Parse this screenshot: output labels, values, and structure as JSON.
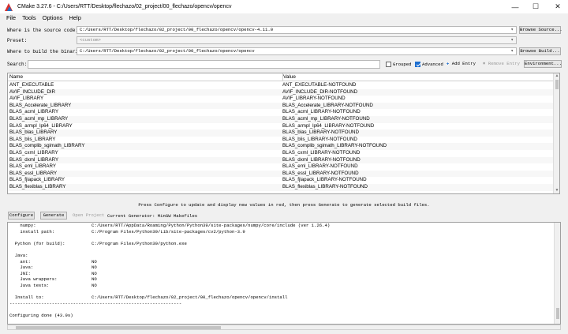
{
  "window": {
    "title": "CMake 3.27.6 - C:/Users/RTT/Desktop/flechazo/02_project/00_flechazo/opencv/opencv",
    "minimize": "—",
    "maximize": "☐",
    "close": "✕"
  },
  "menu": [
    "File",
    "Tools",
    "Options",
    "Help"
  ],
  "source": {
    "label": "Where is the source code:",
    "value": "C:/Users/RTT/Desktop/flechazo/02_project/00_flechazo/opencv/opencv-4.11.0",
    "browse_label": "Browse Source..."
  },
  "preset": {
    "label": "Preset:",
    "value": "<custom>"
  },
  "build": {
    "label": "Where to build the binaries:",
    "value": "C:/Users/RTT/Desktop/flechazo/02_project/00_flechazo/opencv/opencv",
    "browse_label": "Browse Build..."
  },
  "search": {
    "label": "Search:",
    "value": "",
    "grouped_label": "Grouped",
    "grouped_checked": false,
    "advanced_label": "Advanced",
    "advanced_checked": true,
    "add_entry_label": "Add Entry",
    "remove_entry_label": "Remove Entry",
    "environment_label": "Environment..."
  },
  "table": {
    "headers": [
      "Name",
      "Value"
    ],
    "rows": [
      {
        "name": "ANT_EXECUTABLE",
        "value": "ANT_EXECUTABLE-NOTFOUND"
      },
      {
        "name": "AVIF_INCLUDE_DIR",
        "value": "AVIF_INCLUDE_DIR-NOTFOUND"
      },
      {
        "name": "AVIF_LIBRARY",
        "value": "AVIF_LIBRARY-NOTFOUND"
      },
      {
        "name": "BLAS_Accelerate_LIBRARY",
        "value": "BLAS_Accelerate_LIBRARY-NOTFOUND"
      },
      {
        "name": "BLAS_acml_LIBRARY",
        "value": "BLAS_acml_LIBRARY-NOTFOUND"
      },
      {
        "name": "BLAS_acml_mp_LIBRARY",
        "value": "BLAS_acml_mp_LIBRARY-NOTFOUND"
      },
      {
        "name": "BLAS_armpl_lp64_LIBRARY",
        "value": "BLAS_armpl_lp64_LIBRARY-NOTFOUND"
      },
      {
        "name": "BLAS_blas_LIBRARY",
        "value": "BLAS_blas_LIBRARY-NOTFOUND"
      },
      {
        "name": "BLAS_blis_LIBRARY",
        "value": "BLAS_blis_LIBRARY-NOTFOUND"
      },
      {
        "name": "BLAS_complib_sgimath_LIBRARY",
        "value": "BLAS_complib_sgimath_LIBRARY-NOTFOUND"
      },
      {
        "name": "BLAS_cxml_LIBRARY",
        "value": "BLAS_cxml_LIBRARY-NOTFOUND"
      },
      {
        "name": "BLAS_dxml_LIBRARY",
        "value": "BLAS_dxml_LIBRARY-NOTFOUND"
      },
      {
        "name": "BLAS_eml_LIBRARY",
        "value": "BLAS_eml_LIBRARY-NOTFOUND"
      },
      {
        "name": "BLAS_essl_LIBRARY",
        "value": "BLAS_essl_LIBRARY-NOTFOUND"
      },
      {
        "name": "BLAS_fjlapack_LIBRARY",
        "value": "BLAS_fjlapack_LIBRARY-NOTFOUND"
      },
      {
        "name": "BLAS_flexiblas_LIBRARY",
        "value": "BLAS_flexiblas_LIBRARY-NOTFOUND"
      }
    ]
  },
  "info_message": "Press Configure to update and display new values in red, then press Generate to generate selected build files.",
  "actions": {
    "configure_label": "Configure",
    "generate_label": "Generate",
    "open_project_label": "Open Project",
    "current_generator": "Current Generator: MinGW Makefiles"
  },
  "log_lines": [
    "    numpy:                     C:/Users/RTT/AppData/Roaming/Python/Python39/site-packages/numpy/core/include (ver 1.26.4)",
    "    install path:              C:/Program Files/Python39/Lib/site-packages/cv2/python-3.9",
    "",
    "  Python (for build):          C:/Program Files/Python39/python.exe",
    "",
    "  Java:",
    "    ant:                       NO",
    "    Java:                      NO",
    "    JNI:                       NO",
    "    Java wrappers:             NO",
    "    Java tests:                NO",
    "",
    "  Install to:                  C:/Users/RTT/Desktop/flechazo/02_project/00_flechazo/opencv/opencv/install",
    "-----------------------------------------------------------------",
    "",
    "Configuring done (43.9s)"
  ]
}
